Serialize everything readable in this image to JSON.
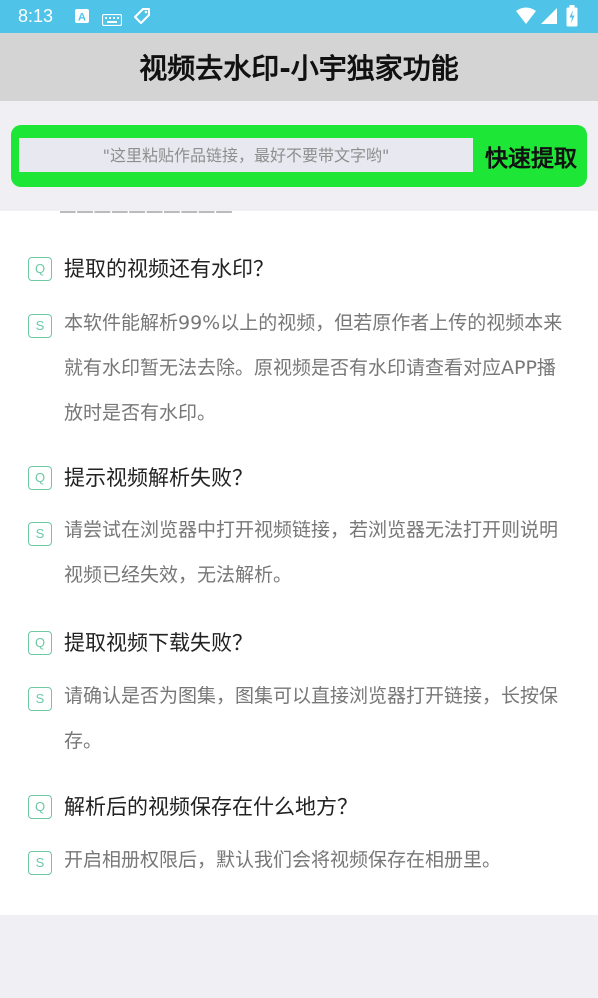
{
  "status_bar": {
    "time": "8:13"
  },
  "header": {
    "title": "视频去水印-小宇独家功能"
  },
  "search": {
    "placeholder": "\"这里粘贴作品链接，最好不要带文字哟\"",
    "button_label": "快速提取"
  },
  "faq": {
    "q_badge": "Q",
    "a_badge": "S",
    "items": [
      {
        "question": "提取的视频还有水印？",
        "answer": "本软件能解析99%以上的视频，但若原作者上传的视频本来就有水印暂无法去除。原视频是否有水印请查看对应APP播放时是否有水印。"
      },
      {
        "question": "提示视频解析失败？",
        "answer": "请尝试在浏览器中打开视频链接，若浏览器无法打开则说明视频已经失效，无法解析。"
      },
      {
        "question": "提取视频下载失败？",
        "answer": "请确认是否为图集，图集可以直接浏览器打开链接，长按保存。"
      },
      {
        "question": "解析后的视频保存在什么地方？",
        "answer": "开启相册权限后，默认我们会将视频保存在相册里。"
      }
    ]
  },
  "colors": {
    "status_bar": "#4fc3e8",
    "title_bar": "#d4d4d4",
    "accent_green": "#1ee637",
    "badge": "#6cc9a4"
  }
}
